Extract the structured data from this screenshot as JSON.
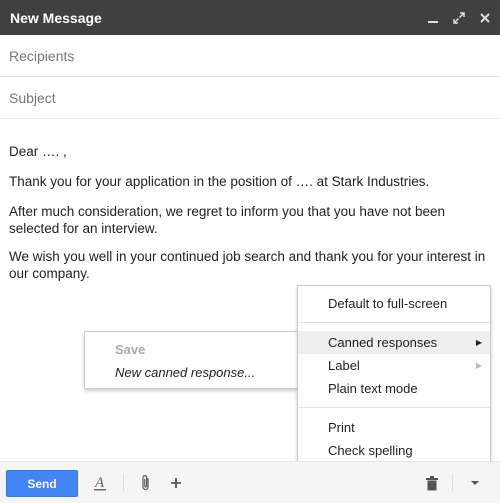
{
  "window": {
    "title": "New Message"
  },
  "fields": {
    "recipients_placeholder": "Recipients",
    "subject_placeholder": "Subject"
  },
  "body": {
    "greeting": "Dear …. ,",
    "paragraph1": "Thank you for your application in the position of …. at Stark Industries.",
    "paragraph2": "After much consideration, we regret to inform you that you have not been selected for an interview.",
    "paragraph3": "We wish you well in your continued job search and thank you for your interest in our company."
  },
  "toolbar": {
    "send_label": "Send"
  },
  "more_menu": {
    "items": [
      {
        "label": "Default to full-screen"
      },
      {
        "label": "Canned responses",
        "has_submenu": true,
        "active": true
      },
      {
        "label": "Label",
        "has_submenu": true
      },
      {
        "label": "Plain text mode"
      },
      {
        "label": "Print"
      },
      {
        "label": "Check spelling"
      }
    ]
  },
  "canned_submenu": {
    "items": [
      {
        "label": "Save",
        "disabled": true
      },
      {
        "label": "New canned response..."
      }
    ]
  },
  "colors": {
    "titlebar": "#404040",
    "send": "#4285f4",
    "menu_hover": "#eeeeee"
  },
  "icons": [
    "minimize-icon",
    "expand-icon",
    "close-icon",
    "text-format-icon",
    "attach-icon",
    "plus-icon",
    "trash-icon",
    "more-options-icon"
  ]
}
